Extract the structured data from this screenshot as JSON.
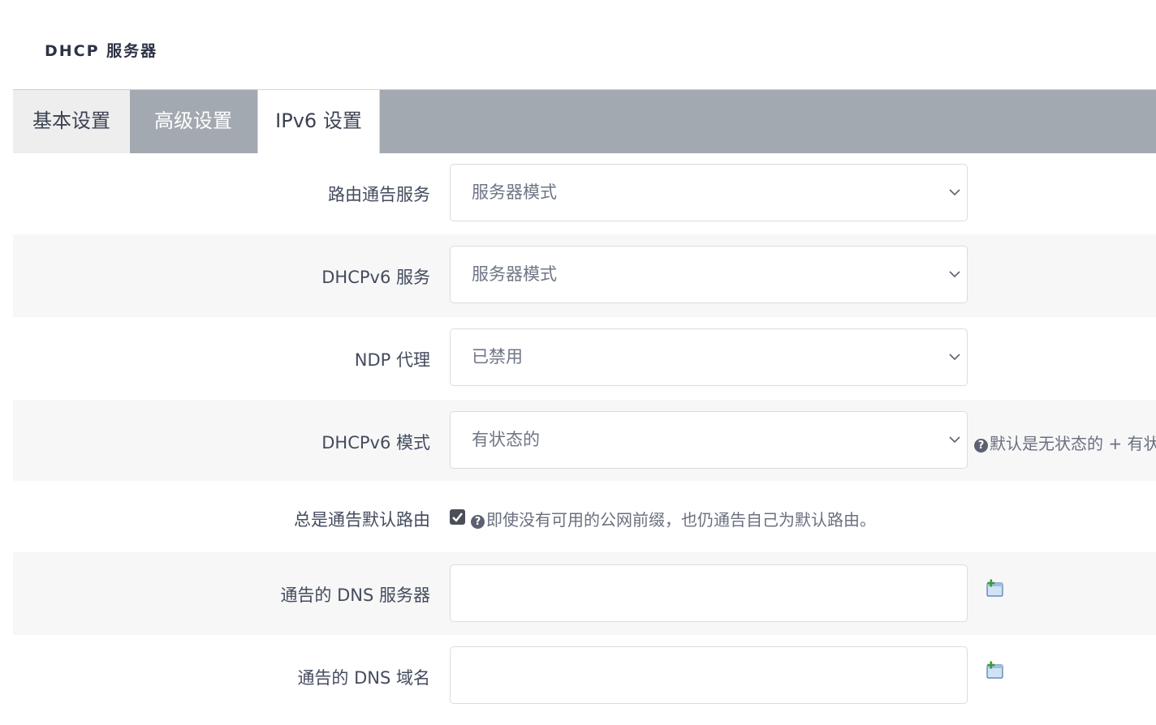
{
  "section": {
    "title": "DHCP 服务器"
  },
  "tabs": [
    {
      "label": "基本设置",
      "active": false
    },
    {
      "label": "高级设置",
      "active": false
    },
    {
      "label": "IPv6 设置",
      "active": true
    }
  ],
  "fields": {
    "ra_service": {
      "label": "路由通告服务",
      "value": "服务器模式"
    },
    "dhcpv6_service": {
      "label": "DHCPv6 服务",
      "value": "服务器模式"
    },
    "ndp_proxy": {
      "label": "NDP 代理",
      "value": "已禁用"
    },
    "dhcpv6_mode": {
      "label": "DHCPv6 模式",
      "value": "有状态的",
      "help": "默认是无状态的 + 有状"
    },
    "ra_default": {
      "label": "总是通告默认路由",
      "checked": true,
      "help": "即使没有可用的公网前缀，也仍通告自己为默认路由。"
    },
    "dns_servers": {
      "label": "通告的 DNS 服务器",
      "value": ""
    },
    "dns_domains": {
      "label": "通告的 DNS 域名",
      "value": ""
    }
  },
  "colors": {
    "tabbar": "#a3a9b1",
    "active_tab": "#ffffff",
    "checkbox": "#4b4f58"
  }
}
